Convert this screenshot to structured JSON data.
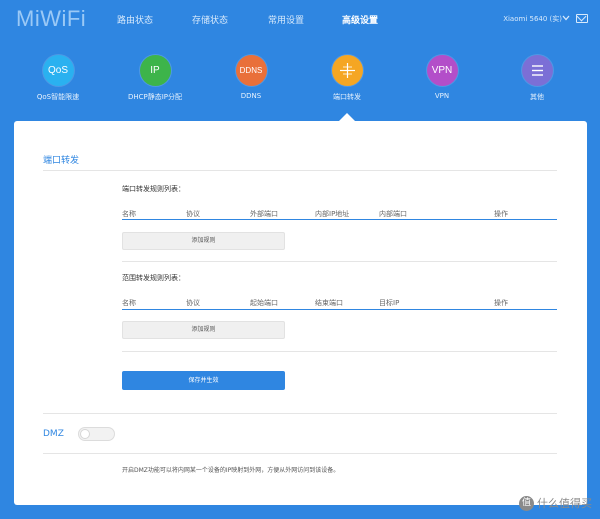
{
  "header": {
    "logo": "MiWiFi",
    "nav": [
      {
        "label": "路由状态"
      },
      {
        "label": "存储状态"
      },
      {
        "label": "常用设置"
      },
      {
        "label": "高级设置",
        "active": true
      }
    ],
    "device": "Xiaomi 5640 (实)"
  },
  "tools": [
    {
      "abbr": "QoS",
      "label": "QoS智能限速",
      "color": "#2ab1f0"
    },
    {
      "abbr": "IP",
      "label": "DHCP静态IP分配",
      "color": "#3db44a"
    },
    {
      "abbr": "DDNS",
      "label": "DDNS",
      "color": "#e9703a"
    },
    {
      "abbr": "",
      "label": "端口转发",
      "color": "#f5a623",
      "active": true
    },
    {
      "abbr": "VPN",
      "label": "VPN",
      "color": "#b34ec9"
    },
    {
      "abbr": "",
      "label": "其他",
      "color": "#7b6fd6"
    }
  ],
  "port_forward": {
    "title": "端口转发",
    "rule_list": {
      "title": "端口转发规则列表：",
      "columns": [
        "名称",
        "协议",
        "外部端口",
        "内部IP地址",
        "内部端口",
        "操作"
      ],
      "add_label": "添加规则"
    },
    "range_list": {
      "title": "范围转发规则列表：",
      "columns": [
        "名称",
        "协议",
        "起始端口",
        "结束端口",
        "目标IP",
        "操作"
      ],
      "add_label": "添加规则"
    },
    "save_label": "保存并生效"
  },
  "dmz": {
    "label": "DMZ",
    "enabled": false,
    "description": "开启DMZ功能可以将内网某一个设备的IP映射到外网，方便从外网访问到该设备。"
  },
  "watermark": {
    "badge": "值",
    "text": "什么值得买"
  }
}
